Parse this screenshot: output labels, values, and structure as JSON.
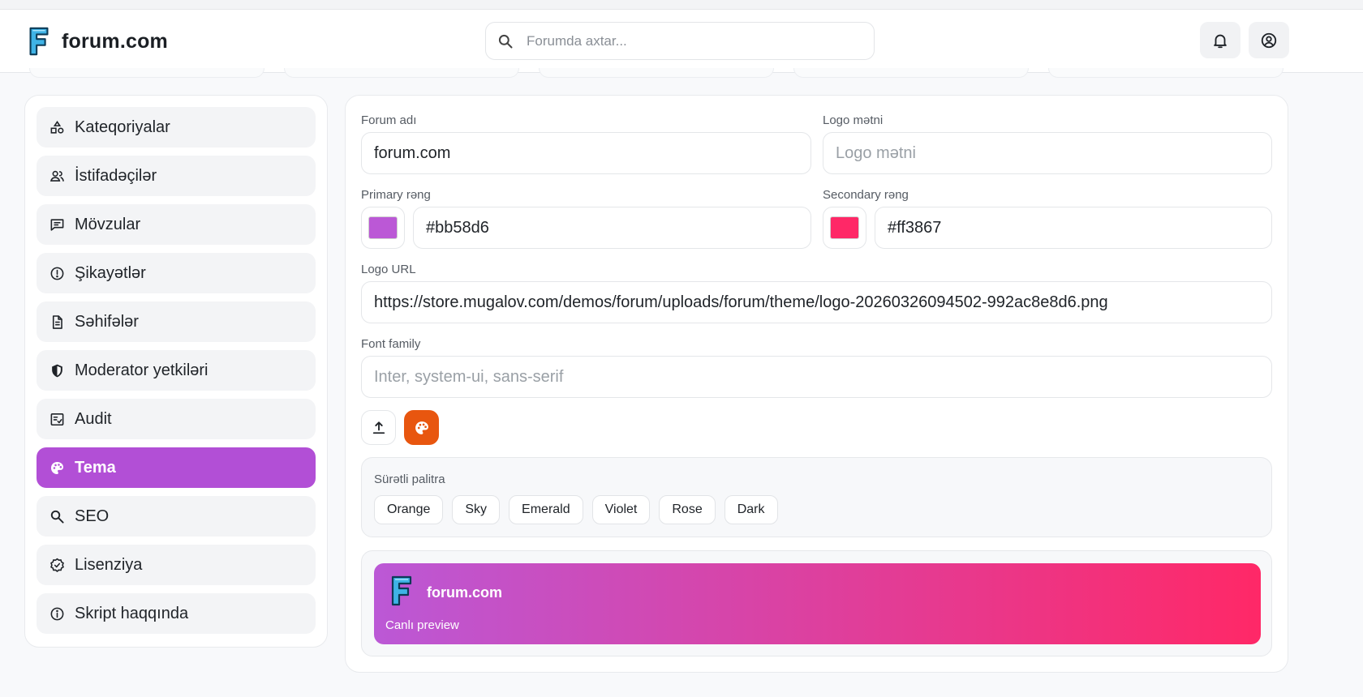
{
  "app": {
    "name": "forum.com"
  },
  "header": {
    "search_placeholder": "Forumda axtar...",
    "icons": [
      "bell-icon",
      "user-circle-icon"
    ]
  },
  "sidebar": {
    "active": "Tema",
    "items": [
      {
        "label": "Kateqoriyalar",
        "icon": "shapes-icon"
      },
      {
        "label": "İstifadəçilər",
        "icon": "users-icon"
      },
      {
        "label": "Mövzular",
        "icon": "message-square-icon"
      },
      {
        "label": "Şikayətlər",
        "icon": "alert-circle-icon"
      },
      {
        "label": "Səhifələr",
        "icon": "file-text-icon"
      },
      {
        "label": "Moderator yetkiləri",
        "icon": "shield-icon"
      },
      {
        "label": "Audit",
        "icon": "audit-checklist-icon"
      },
      {
        "label": "Tema",
        "icon": "palette-icon"
      },
      {
        "label": "SEO",
        "icon": "search-icon"
      },
      {
        "label": "Lisenziya",
        "icon": "badge-check-icon"
      },
      {
        "label": "Skript haqqında",
        "icon": "info-icon"
      }
    ]
  },
  "form": {
    "forum_name": {
      "label": "Forum adı",
      "value": "forum.com"
    },
    "logo_text": {
      "label": "Logo mətni",
      "placeholder": "Logo mətni",
      "value": ""
    },
    "primary_color": {
      "label": "Primary rəng",
      "value": "#bb58d6"
    },
    "secondary_color": {
      "label": "Secondary rəng",
      "value": "#ff3867"
    },
    "logo_url": {
      "label": "Logo URL",
      "value": "https://store.mugalov.com/demos/forum/uploads/forum/theme/logo-20260326094502-992ac8e8d6.png"
    },
    "font_family": {
      "label": "Font family",
      "placeholder": "Inter, system-ui, sans-serif",
      "value": ""
    }
  },
  "actions": {
    "upload_icon": "upload-icon",
    "palette_icon": "palette-icon",
    "palette_button_color": "#e8560f"
  },
  "palette": {
    "title": "Sürətli palitra",
    "options": [
      "Orange",
      "Sky",
      "Emerald",
      "Violet",
      "Rose",
      "Dark"
    ]
  },
  "preview": {
    "name": "forum.com",
    "caption": "Canlı preview"
  },
  "colors": {
    "accent": "#b24fd6",
    "primary": "#bb58d6",
    "secondary": "#ff3867"
  }
}
